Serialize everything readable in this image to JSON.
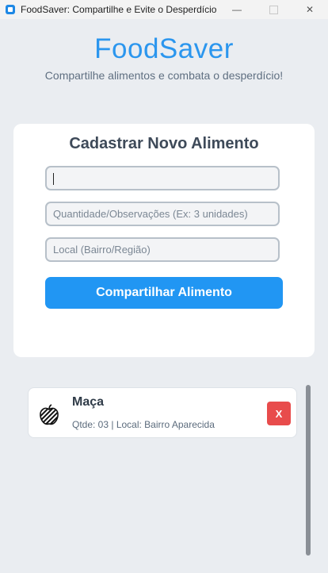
{
  "window": {
    "title": "FoodSaver: Compartilhe e Evite o Desperdício",
    "controls": {
      "minimize": "—",
      "close": "✕"
    }
  },
  "header": {
    "brand": "FoodSaver",
    "tagline": "Compartilhe alimentos e combata o desperdício!"
  },
  "form": {
    "title": "Cadastrar Novo Alimento",
    "name_value": "",
    "name_placeholder": "",
    "quantity_placeholder": "Quantidade/Observações (Ex: 3 unidades)",
    "location_placeholder": "Local (Bairro/Região)",
    "submit_label": "Compartilhar Alimento"
  },
  "items": [
    {
      "icon": "apple-icon",
      "name": "Maça",
      "meta": "Qtde: 03 | Local: Bairro Aparecida",
      "delete_label": "X"
    }
  ],
  "colors": {
    "brand": "#2b96ee",
    "button": "#2196f3",
    "delete": "#e84c4c",
    "background": "#eaedf1"
  }
}
